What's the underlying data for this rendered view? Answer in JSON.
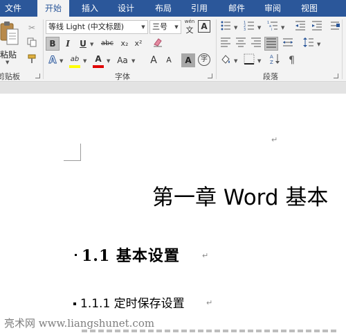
{
  "tabs": [
    {
      "label": "文件",
      "active": false
    },
    {
      "label": "开始",
      "active": true
    },
    {
      "label": "插入",
      "active": false
    },
    {
      "label": "设计",
      "active": false
    },
    {
      "label": "布局",
      "active": false
    },
    {
      "label": "引用",
      "active": false
    },
    {
      "label": "邮件",
      "active": false
    },
    {
      "label": "审阅",
      "active": false
    },
    {
      "label": "视图",
      "active": false
    }
  ],
  "clipboard": {
    "paste_label": "粘贴",
    "group_label": "剪贴板"
  },
  "font": {
    "group_label": "字体",
    "font_name": "等线 Light (中文标题)",
    "font_size": "三号",
    "wen_label": "wén",
    "wen_char": "文",
    "buttons": {
      "bold": "B",
      "italic": "I",
      "underline": "U",
      "strike": "abc",
      "subscript": "x₂",
      "superscript": "x²",
      "text_effects": "A",
      "highlight": "ab",
      "font_color": "A",
      "change_case": "Aa",
      "grow": "A",
      "shrink": "A",
      "char_shading": "A",
      "enclose": "字",
      "char_border": "A"
    },
    "colors": {
      "highlight": "#ffff00",
      "font_color": "#e00000",
      "effects": "#2b579a"
    }
  },
  "paragraph": {
    "group_label": "段落"
  },
  "document": {
    "chapter_title": "第一章 Word 基本",
    "heading_1_1": "1.1  基本设置",
    "heading_1_1_1": "1.1.1  定时保存设置",
    "para_mark": "↵"
  },
  "watermark": "亮术网 www.liangshunet.com"
}
